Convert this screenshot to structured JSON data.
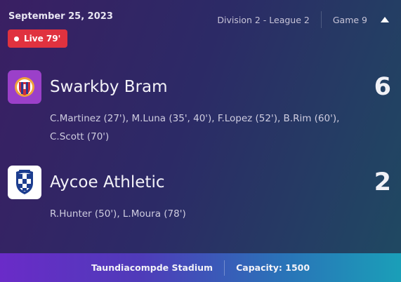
{
  "header": {
    "date": "September 25, 2023",
    "division": "Division 2 - League 2",
    "game": "Game 9",
    "collapse_icon": "chevron-up-icon"
  },
  "status": {
    "live_label": "Live 79'",
    "color": "#e0323f"
  },
  "teams": [
    {
      "name": "Swarkby Bram",
      "score": "6",
      "scorers": "C.Martinez (27'), M.Luna (35', 40'), F.Lopez (52'), B.Rim (60'), C.Scott (70')",
      "crest_icon": "club-crest-icon",
      "crest_color": "#9b40c9"
    },
    {
      "name": "Aycoe Athletic",
      "score": "2",
      "scorers": "R.Hunter (50'), L.Moura (78')",
      "crest_icon": "club-crest-icon",
      "crest_color": "#ffffff"
    }
  ],
  "footer": {
    "stadium": "Taundiacompde Stadium",
    "capacity": "Capacity: 1500"
  }
}
